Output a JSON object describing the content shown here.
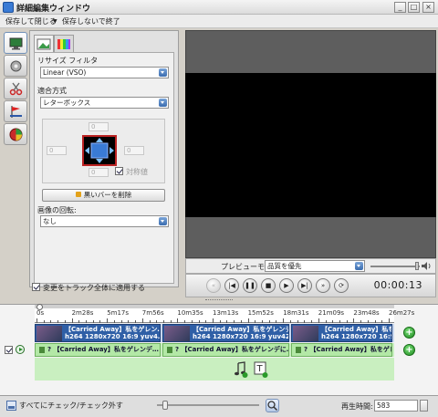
{
  "window": {
    "title": "詳細編集ウィンドウ",
    "minimize_glyph": "_",
    "maximize_glyph": "□",
    "close_glyph": "×"
  },
  "menu": {
    "save_close": "保存して閉じる",
    "dropdown_glyph": "▼",
    "close_no_save": "保存しないで終了"
  },
  "left_tools": [
    {
      "name": "video-settings-tool",
      "icon": "monitor-icon",
      "active": true
    },
    {
      "name": "effects-tool",
      "icon": "gear-icon",
      "active": false
    },
    {
      "name": "cut-tool",
      "icon": "scissors-icon",
      "active": false
    },
    {
      "name": "chapter-tool",
      "icon": "flag-icon",
      "active": false
    },
    {
      "name": "color-tool",
      "icon": "color-wheel-icon",
      "active": false
    }
  ],
  "panel": {
    "resize_filter_label": "リサイズ フィルタ",
    "resize_filter_value": "Linear (VSO)",
    "fit_method_label": "適合方式",
    "fit_method_value": "レターボックス",
    "padding_top": "0",
    "padding_left": "0",
    "padding_right": "0",
    "padding_bottom": "0",
    "symmetric_label": "対称値",
    "remove_black_bars_label": "黒いバーを削除",
    "rotation_label": "画像の回転:",
    "rotation_value": "なし",
    "apply_all_label": "変更をトラック全体に適用する"
  },
  "preview": {
    "mode_label": "プレビューモード",
    "mode_value": "品質を優先",
    "volume_level": 0.95,
    "timecode": "00:00:13",
    "transport": {
      "prev_glyph": "«",
      "start_glyph": "|◀",
      "pause_glyph": "❚❚",
      "stop_glyph": "■",
      "play_glyph": "▶",
      "end_glyph": "▶|",
      "next_glyph": "»",
      "loop_glyph": "⟳"
    }
  },
  "timeline": {
    "ticks": [
      "0s",
      "2m28s",
      "5m17s",
      "7m56s",
      "10m35s",
      "13m13s",
      "15m52s",
      "18m31s",
      "21m09s",
      "23m48s",
      "26m27s"
    ],
    "playhead_fraction": 0.005,
    "video_clips": [
      {
        "line1": "【Carried Away】私をゲレン…",
        "line2": "h264 1280x720 16:9 yuv4…"
      },
      {
        "line1": "【Carried Away】私をゲレンデ…",
        "line2": "h264 1280x720 16:9 yuv420…"
      },
      {
        "line1": "【Carried Away】私をゲレンデ…",
        "line2": "h264 1280x720 16:9 yuv420…"
      }
    ],
    "audio_clips": [
      {
        "text": "? 【Carried Away】私をゲレンデ…"
      },
      {
        "text": "? 【Carried Away】私をゲレンデに…"
      },
      {
        "text": "? 【Carried Away】私をゲレンデ…"
      }
    ],
    "add_glyph": "+"
  },
  "bottom": {
    "check_all_label": "すべてにチェック/チェック外す",
    "duration_label": "再生時間:",
    "duration_value": "583",
    "zoom_level": 0.05
  },
  "colors": {
    "video_clip": "#2f5fa6",
    "audio_clip": "#b3e8a6",
    "accent": "#3a6db0"
  }
}
